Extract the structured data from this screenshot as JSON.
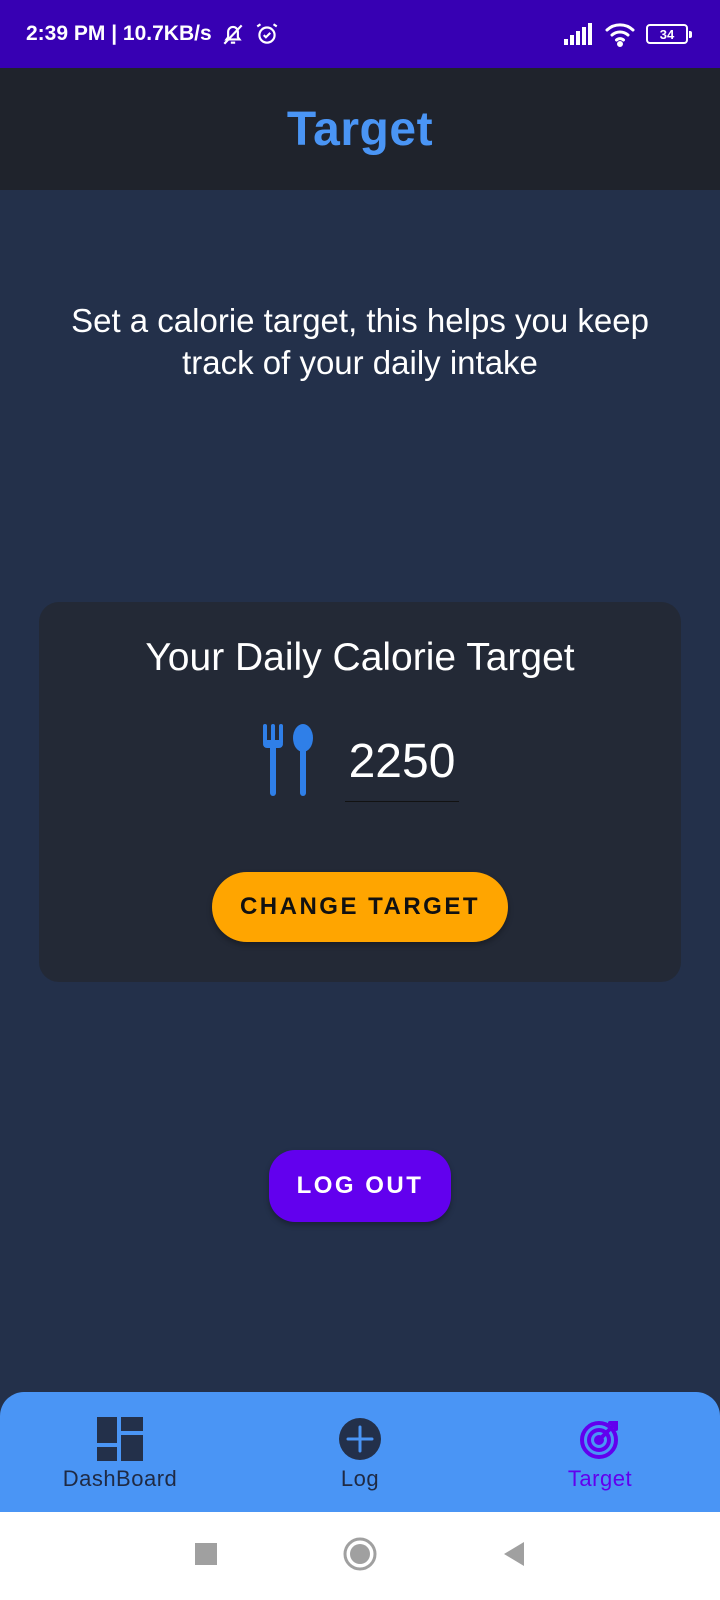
{
  "status_bar": {
    "time_speed": "2:39 PM | 10.7KB/s",
    "battery_level": "34",
    "icons": [
      "bell-off-icon",
      "alarm-icon",
      "signal-icon",
      "wifi-icon",
      "battery-icon"
    ]
  },
  "app_bar": {
    "title": "Target"
  },
  "intro": {
    "text": "Set a calorie target, this helps you keep track of your daily intake"
  },
  "target_card": {
    "title": "Your Daily Calorie Target",
    "icon": "utensils-icon",
    "value": "2250",
    "change_button_label": "CHANGE TARGET"
  },
  "logout": {
    "label": "LOG OUT"
  },
  "bottom_nav": {
    "items": [
      {
        "label": "DashBoard",
        "icon": "dashboard-icon",
        "active": false
      },
      {
        "label": "Log",
        "icon": "add-circle-icon",
        "active": false
      },
      {
        "label": "Target",
        "icon": "target-icon",
        "active": true
      }
    ]
  },
  "system_nav": {
    "icons": [
      "recents-icon",
      "home-icon",
      "back-icon"
    ]
  },
  "colors": {
    "status_bar": "#3700b3",
    "app_bar": "#1f232c",
    "background": "#23304a",
    "accent_blue": "#4a95f5",
    "accent_orange": "#ffa500",
    "accent_purple": "#6200ee"
  }
}
